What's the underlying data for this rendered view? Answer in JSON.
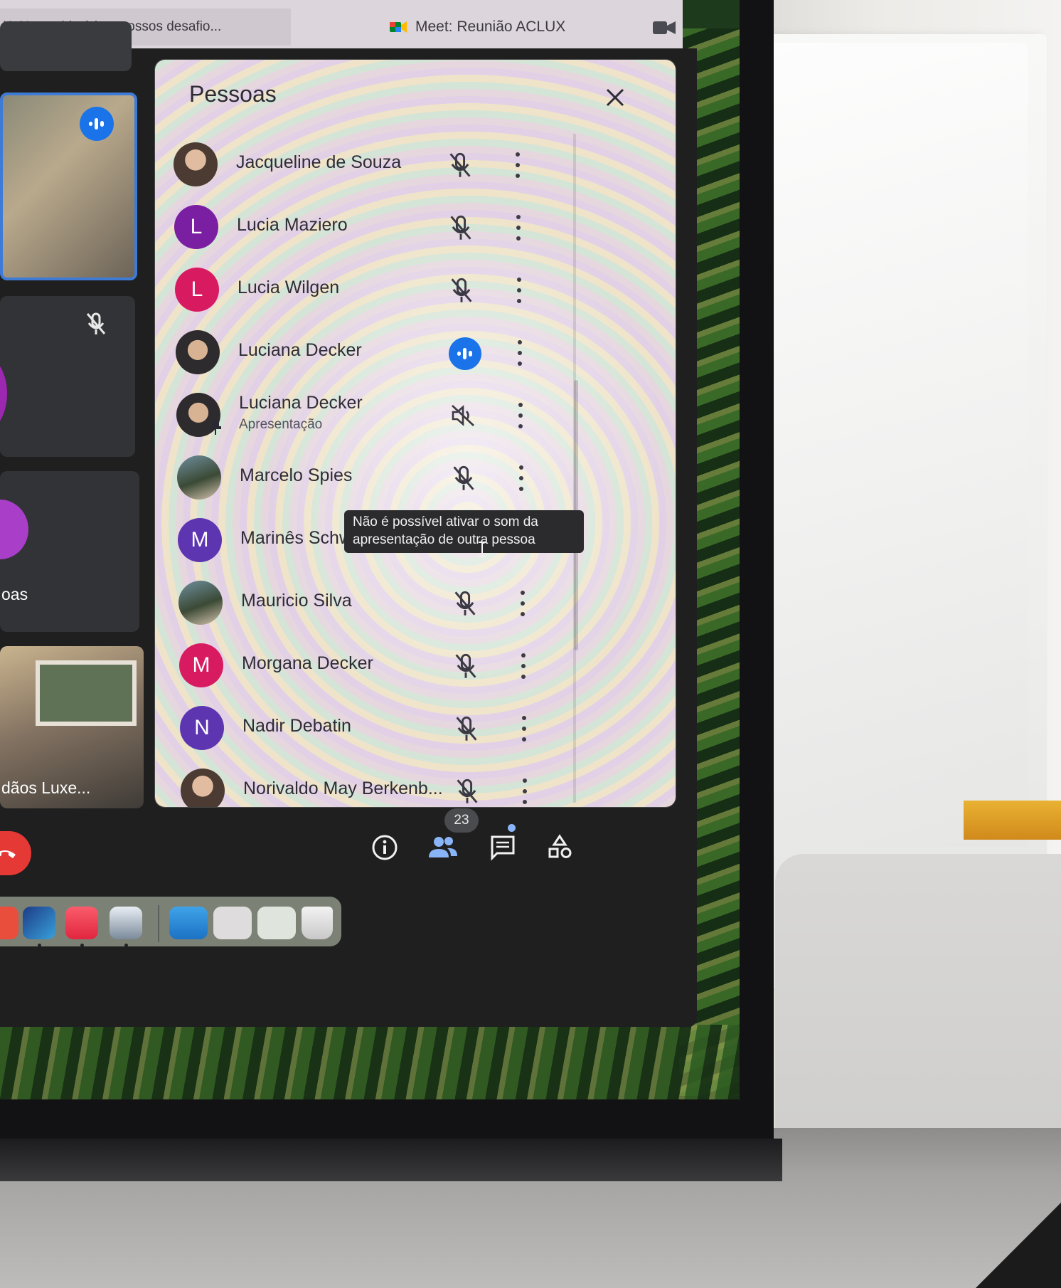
{
  "browser": {
    "tabs": [
      {
        "label": "K: Nossa história e nossos desafio..."
      },
      {
        "label": "Meet: Reunião ACLUX"
      }
    ]
  },
  "tiles": {
    "tile3_name": "oas",
    "tile4_name": "dãos Luxe..."
  },
  "panel": {
    "title": "Pessoas",
    "participants": [
      {
        "name": "Jacqueline de Souza",
        "status": "muted"
      },
      {
        "name": "Lucia Maziero",
        "initial": "L",
        "status": "muted"
      },
      {
        "name": "Lucia Wilgen",
        "initial": "L",
        "status": "muted"
      },
      {
        "name": "Luciana Decker",
        "status": "speaking"
      },
      {
        "name": "Luciana Decker",
        "subtitle": "Apresentação",
        "status": "presentation-muted"
      },
      {
        "name": "Marcelo Spies",
        "status": "muted"
      },
      {
        "name": "Marinês Schw",
        "initial": "M",
        "status": "muted"
      },
      {
        "name": "Mauricio Silva",
        "status": "muted"
      },
      {
        "name": "Morgana Decker",
        "initial": "M",
        "status": "muted"
      },
      {
        "name": "Nadir Debatin",
        "initial": "N",
        "status": "muted"
      },
      {
        "name": "Norivaldo May Berkenb...",
        "status": "muted"
      }
    ],
    "tooltip": {
      "line1": "Não é possível ativar o som da",
      "line2": "apresentação de outra pessoa"
    }
  },
  "controls": {
    "people_count": "23",
    "icons": [
      "info-icon",
      "people-icon",
      "chat-icon",
      "activities-icon"
    ]
  },
  "colors": {
    "avatar_purple": "#7b1fa2",
    "avatar_pink": "#d81b60",
    "avatar_indigo": "#5e35b1",
    "speaking_blue": "#1a73e8",
    "leave_red": "#e53935"
  }
}
